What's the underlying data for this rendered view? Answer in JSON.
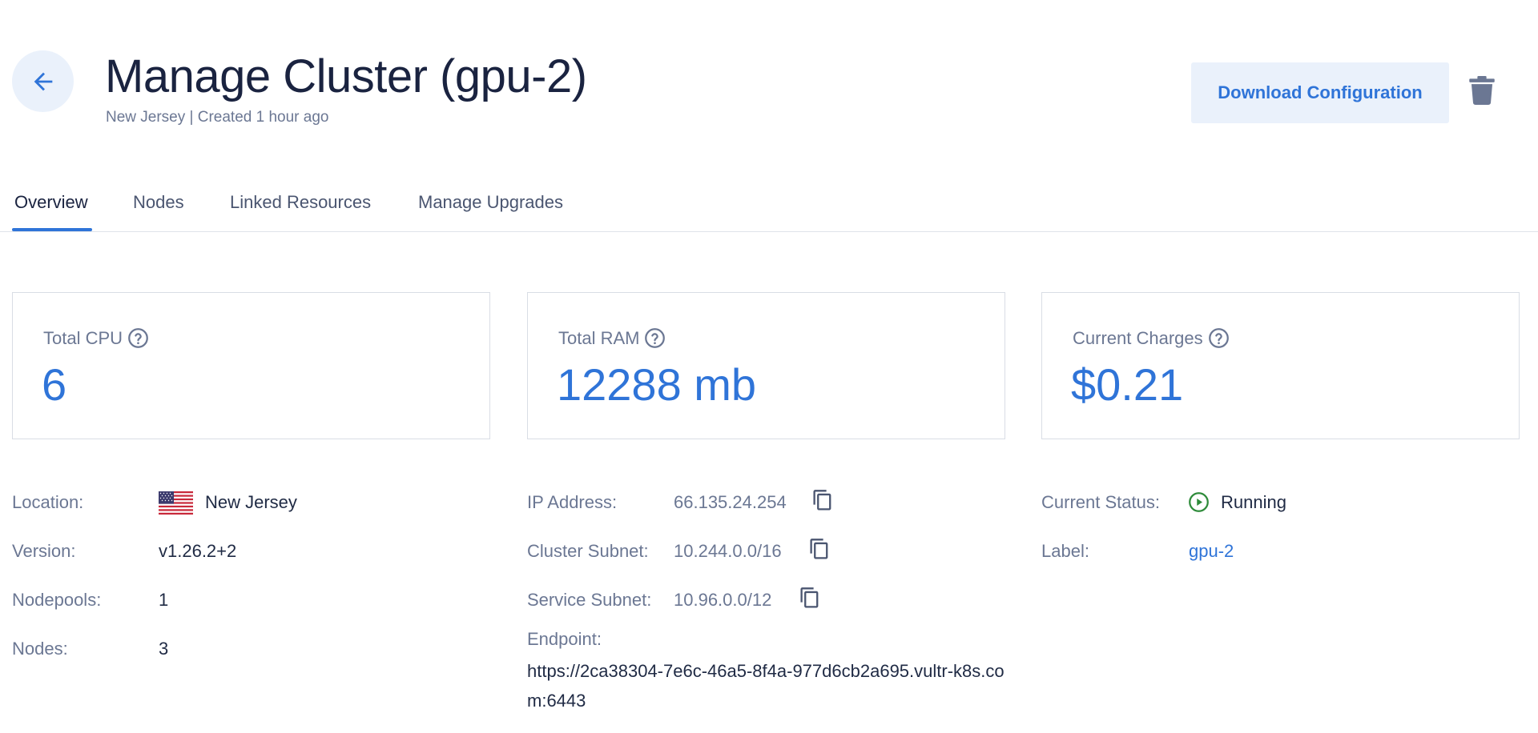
{
  "header": {
    "title": "Manage Cluster (gpu-2)",
    "subtitle": "New Jersey | Created 1 hour ago",
    "download_label": "Download Configuration",
    "back_icon": "arrow-left-icon",
    "delete_icon": "trash-icon"
  },
  "tabs": [
    {
      "label": "Overview",
      "active": true
    },
    {
      "label": "Nodes",
      "active": false
    },
    {
      "label": "Linked Resources",
      "active": false
    },
    {
      "label": "Manage Upgrades",
      "active": false
    }
  ],
  "cards": [
    {
      "label": "Total CPU",
      "value": "6"
    },
    {
      "label": "Total RAM",
      "value": "12288 mb"
    },
    {
      "label": "Current Charges",
      "value": "$0.21"
    }
  ],
  "details_left": {
    "location_label": "Location:",
    "location_value": "New Jersey",
    "version_label": "Version:",
    "version_value": "v1.26.2+2",
    "nodepools_label": "Nodepools:",
    "nodepools_value": "1",
    "nodes_label": "Nodes:",
    "nodes_value": "3"
  },
  "details_mid": {
    "ip_label": "IP Address:",
    "ip_value": "66.135.24.254",
    "cluster_subnet_label": "Cluster Subnet:",
    "cluster_subnet_value": "10.244.0.0/16",
    "service_subnet_label": "Service Subnet:",
    "service_subnet_value": "10.96.0.0/12",
    "endpoint_label": "Endpoint:",
    "endpoint_value": "https://2ca38304-7e6c-46a5-8f4a-977d6cb2a695.vultr-k8s.com:6443"
  },
  "details_right": {
    "status_label": "Current Status:",
    "status_value": "Running",
    "label_label": "Label:",
    "label_value": "gpu-2"
  },
  "colors": {
    "accent": "#2f74d8",
    "accent_bg": "#eaf1fb",
    "status_running": "#2e8b3a",
    "muted_text": "#6b7793"
  }
}
